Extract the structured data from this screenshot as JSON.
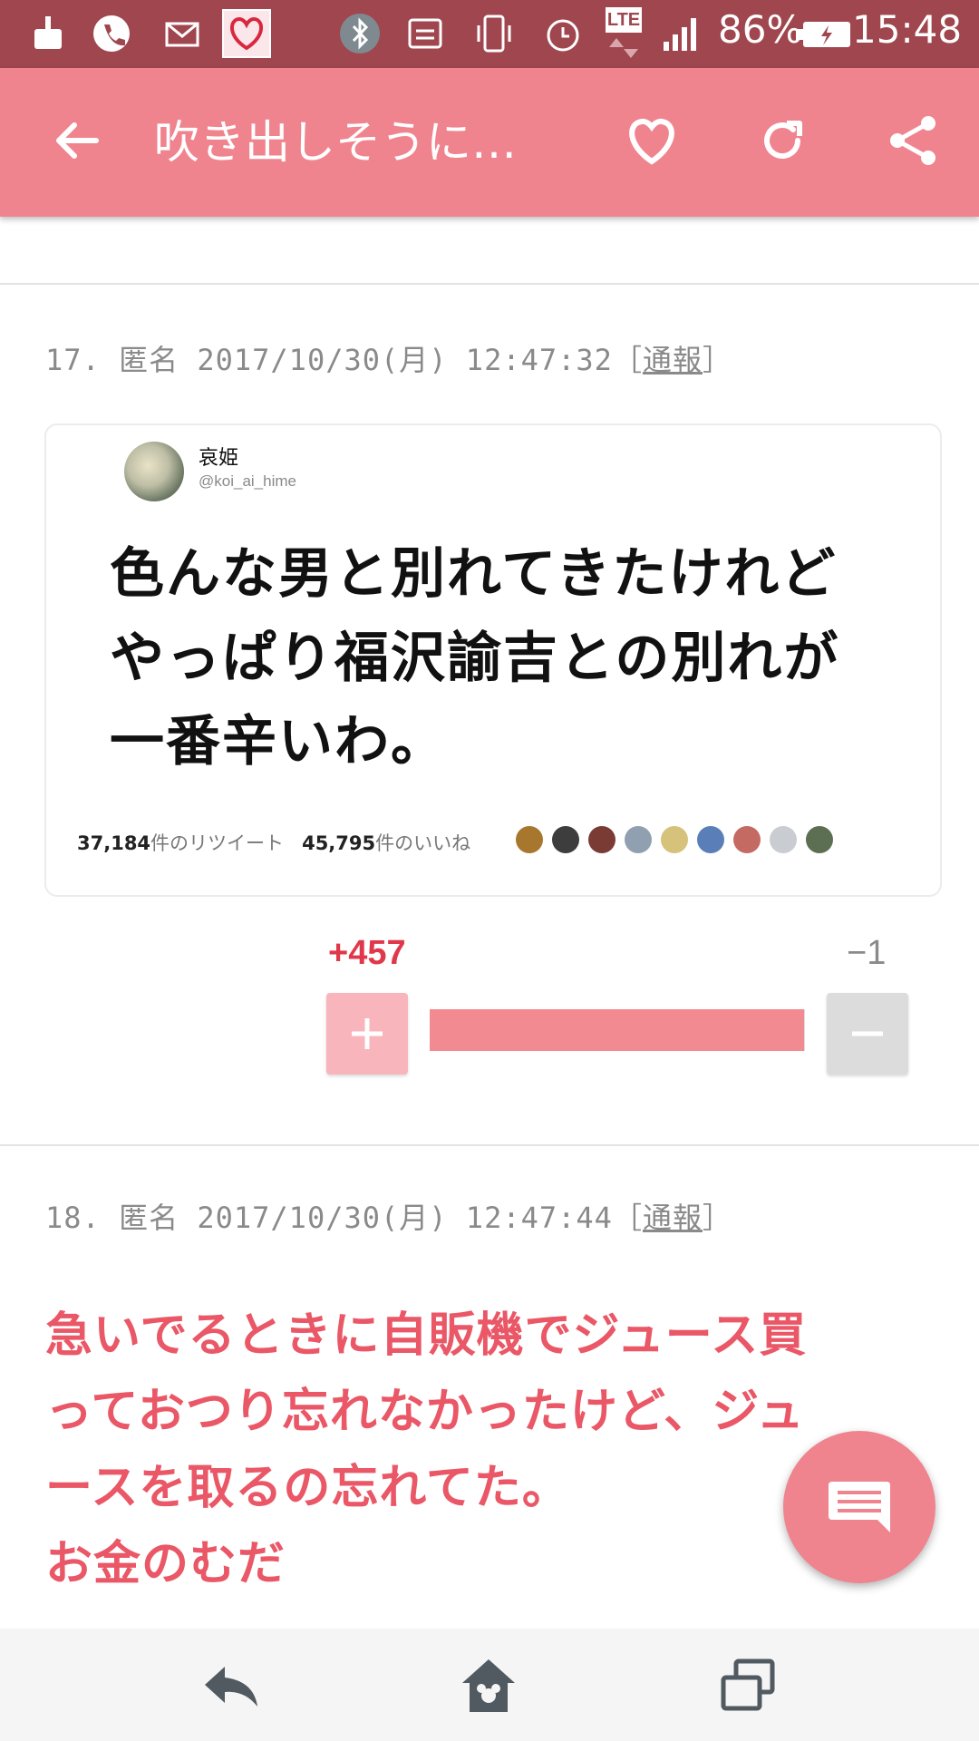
{
  "status_bar": {
    "battery": "86%",
    "time": "15:48",
    "network": "LTE"
  },
  "app_bar": {
    "title": "吹き出しそうに…"
  },
  "comments": [
    {
      "number": "17.",
      "author": "匿名",
      "datetime": "2017/10/30(月) 12:47:32",
      "report_open": "［",
      "report_label": "通報",
      "report_close": "］",
      "tweet": {
        "username": "哀姫",
        "handle": "@koi_ai_hime",
        "lines": [
          "色んな男と別れてきたけれど",
          "やっぱり福沢諭吉との別れが",
          "一番辛いわ。"
        ],
        "retweets_count": "37,184",
        "retweets_label": "件のリツイート",
        "likes_count": "45,795",
        "likes_label": "件のいいね"
      },
      "votes": {
        "plus": "+457",
        "minus": "−1",
        "plus_ratio": 0.998
      }
    },
    {
      "number": "18.",
      "author": "匿名",
      "datetime": "2017/10/30(月) 12:47:44",
      "report_open": "［",
      "report_label": "通報",
      "report_close": "］",
      "lines": [
        "急いでるときに自販機でジュース買",
        "っておつり忘れなかったけど、ジュ",
        "ースを取るの忘れてた。",
        "お金のむだ"
      ]
    }
  ],
  "colors": {
    "status_bar": "#a0464f",
    "app_bar": "#f0848e",
    "plus_count": "#e0384a",
    "comment_text": "#ea5766",
    "vote_fill": "#f28a92"
  }
}
